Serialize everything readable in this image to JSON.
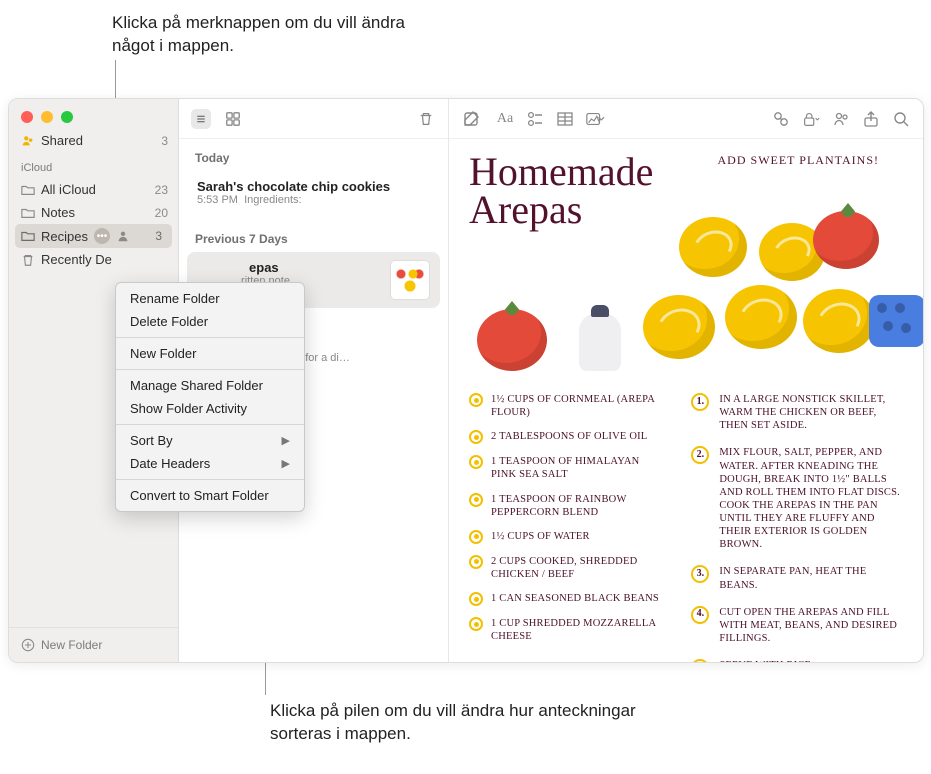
{
  "callouts": {
    "top": "Klicka på merknappen om du vill ändra något i mappen.",
    "bottom": "Klicka på pilen om du vill ändra hur anteckningar sorteras i mappen."
  },
  "sidebar": {
    "shared": {
      "label": "Shared",
      "count": "3"
    },
    "section": "iCloud",
    "items": [
      {
        "label": "All iCloud",
        "count": "23"
      },
      {
        "label": "Notes",
        "count": "20"
      },
      {
        "label": "Recipes",
        "count": "3"
      },
      {
        "label": "Recently De"
      }
    ],
    "footer": "New Folder"
  },
  "context_menu": {
    "rename": "Rename Folder",
    "delete": "Delete Folder",
    "new": "New Folder",
    "manage": "Manage Shared Folder",
    "activity": "Show Folder Activity",
    "sort": "Sort By",
    "date": "Date Headers",
    "convert": "Convert to Smart Folder"
  },
  "noteslist": {
    "section_today": "Today",
    "item1": {
      "title": "Sarah's chocolate chip cookies",
      "time": "5:53 PM",
      "snippet": "Ingredients:"
    },
    "section_prev": "Previous 7 Days",
    "item2": {
      "title_suffix": "epas",
      "sub_suffix": "ritten note"
    },
    "item3": {
      "snippet_suffix": "cken piccata for a di…"
    }
  },
  "note": {
    "title_l1": "Homemade",
    "title_l2": "Arepas",
    "addsweet": "ADD SWEET PLANTAINS!",
    "ingredients": [
      "1½ CUPS OF CORNMEAL (AREPA FLOUR)",
      "2 TABLESPOONS OF OLIVE OIL",
      "1 TEASPOON OF HIMALAYAN PINK SEA SALT",
      "1 TEASPOON OF RAINBOW PEPPERCORN BLEND",
      "1½ CUPS OF WATER",
      "2 CUPS COOKED, SHREDDED CHICKEN / BEEF",
      "1 CAN SEASONED BLACK BEANS",
      "1 CUP SHREDDED MOZZARELLA CHEESE"
    ],
    "steps": [
      "IN A LARGE NONSTICK SKILLET, WARM THE CHICKEN OR BEEF, THEN SET ASIDE.",
      "MIX FLOUR, SALT, PEPPER, AND WATER. AFTER KNEADING THE DOUGH, BREAK INTO 1½\" BALLS AND ROLL THEM INTO FLAT DISCS. COOK THE AREPAS IN THE PAN UNTIL THEY ARE FLUFFY AND THEIR EXTERIOR IS GOLDEN BROWN.",
      "IN SEPARATE PAN, HEAT THE BEANS.",
      "CUT OPEN THE AREPAS AND FILL WITH MEAT, BEANS, AND DESIRED FILLINGS.",
      "SERVE WITH RICE."
    ]
  }
}
